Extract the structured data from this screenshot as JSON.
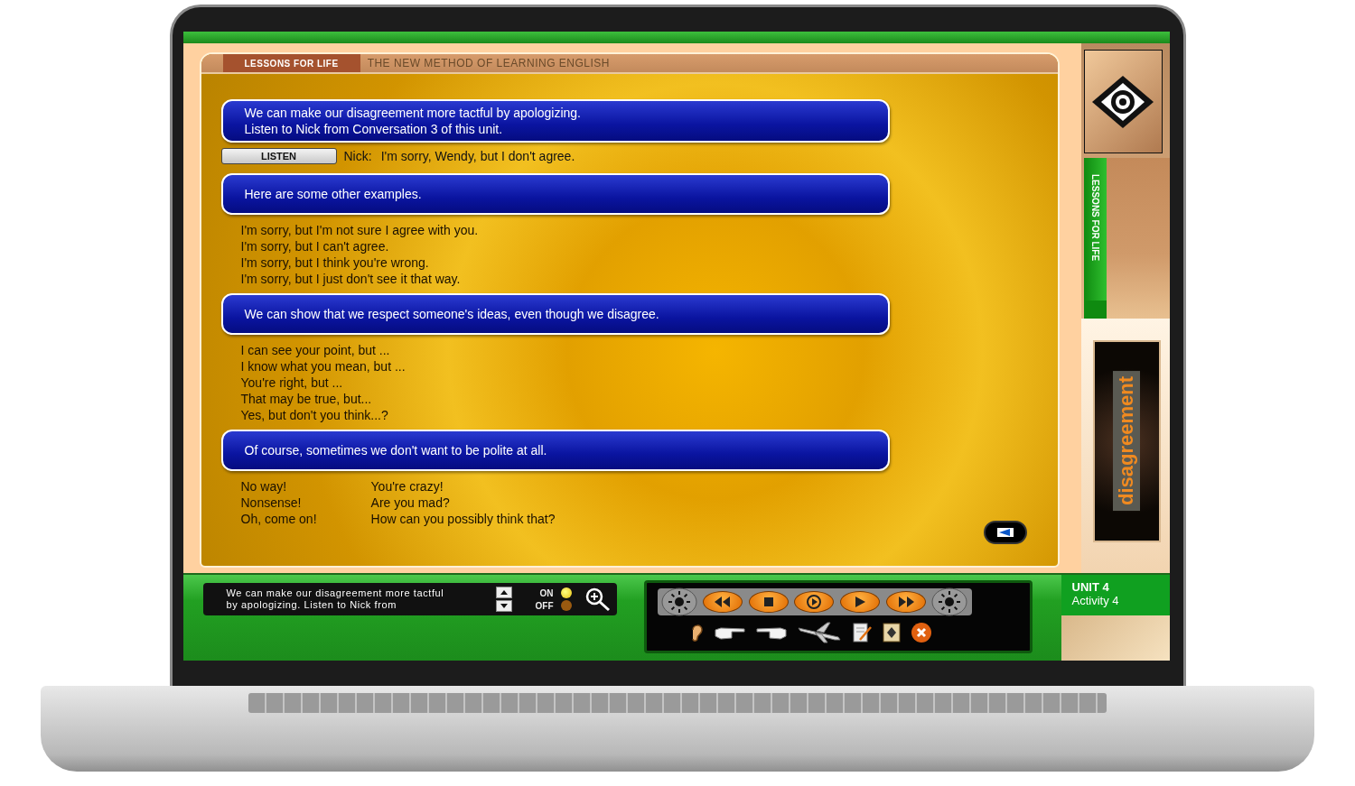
{
  "header": {
    "brand": "LESSONS FOR LIFE",
    "tagline": "THE NEW METHOD OF LEARNING ENGLISH"
  },
  "sections": [
    {
      "banner": [
        "We can make our disagreement more tactful by apologizing.",
        "Listen to Nick from Conversation 3 of this unit."
      ],
      "listen": {
        "button": "LISTEN",
        "speaker": "Nick:",
        "line": "I'm sorry, Wendy, but I don't agree."
      }
    },
    {
      "banner": [
        "Here are some other examples."
      ],
      "examples": [
        [
          "I'm sorry, but I'm not sure I agree with you.",
          "I'm sorry, but I can't agree.",
          "I'm sorry, but I think you're wrong.",
          "I'm sorry, but I just don't see it that way."
        ]
      ]
    },
    {
      "banner": [
        "We can show that we respect someone's ideas, even though we disagree."
      ],
      "examples": [
        [
          "I can see your point, but ...",
          "I know what you mean, but ...",
          "You're right, but ...",
          "That may be true, but...",
          "Yes, but don't you think...?"
        ]
      ]
    },
    {
      "banner": [
        "Of course, sometimes we don't want to be polite at all."
      ],
      "examples": [
        [
          "No way!",
          "Nonsense!",
          "Oh, come on!"
        ],
        [
          "You're crazy!",
          "Are you mad?",
          "How can you possibly think that?"
        ]
      ]
    }
  ],
  "sidebar": {
    "tab": "LESSONS FOR LIFE",
    "topic": "disagreement"
  },
  "caption": {
    "lines": [
      "We can make our disagreement more tactful",
      "by apologizing. Listen to Nick from"
    ]
  },
  "toggle": [
    {
      "label": "ON",
      "selected": true
    },
    {
      "label": "OFF",
      "selected": false
    }
  ],
  "unit": {
    "unit": "UNIT 4",
    "activity": "Activity 4"
  }
}
